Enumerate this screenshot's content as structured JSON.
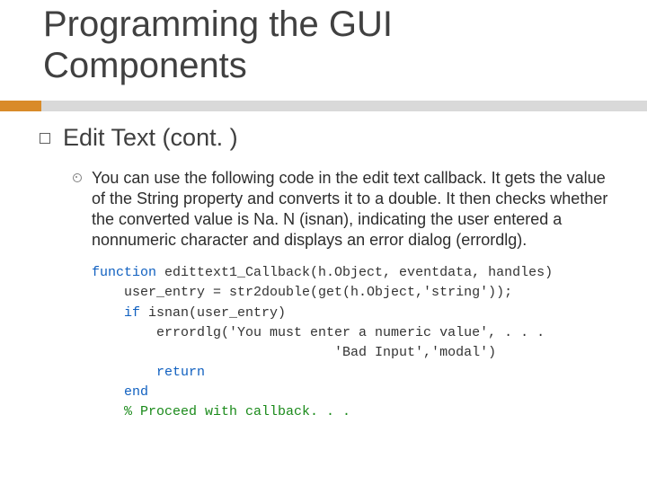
{
  "title_line1": "Programming the GUI",
  "title_line2": "Components",
  "section": "Edit Text (cont. )",
  "paragraph": "You can use the following code in the edit text callback. It gets the value of the String property and converts it to a double. It then checks whether the converted value is Na. N (isnan), indicating the user entered a nonnumeric character and displays an error dialog (errordlg).",
  "code": {
    "l1a": "function",
    "l1b": " edittext1_Callback(h.Object, eventdata, handles)",
    "l2": "    user_entry = str2double(get(h.Object,'string'));",
    "l3a": "    ",
    "l3b": "if",
    "l3c": " isnan(user_entry)",
    "l4": "        errordlg('You must enter a numeric value', . . .",
    "l5": "                              'Bad Input','modal')",
    "l6a": "        ",
    "l6b": "return",
    "l7a": "    ",
    "l7b": "end",
    "l8a": "    ",
    "l8b": "% Proceed with callback. . ."
  }
}
